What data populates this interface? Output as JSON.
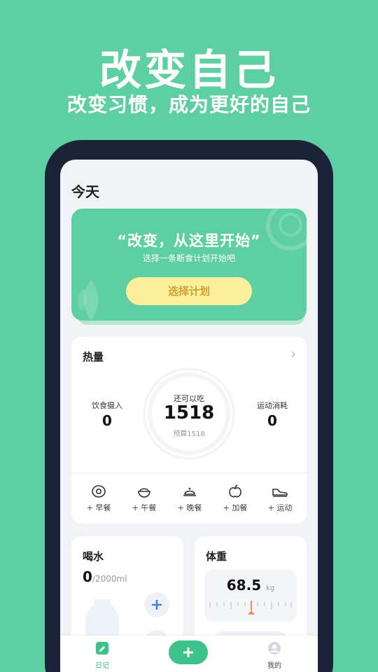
{
  "promo": {
    "title": "改变自己",
    "subtitle": "改变习惯，成为更好的自己"
  },
  "header": {
    "title": "今天"
  },
  "banner": {
    "quote": "“改变，从这里开始”",
    "desc": "选择一条断食计划开始吧",
    "button": "选择计划"
  },
  "calories": {
    "title": "热量",
    "intake_label": "饮食摄入",
    "intake_value": "0",
    "remaining_label": "还可以吃",
    "remaining_value": "1518",
    "budget": "预算1518",
    "burn_label": "运动消耗",
    "burn_value": "0",
    "meals": [
      {
        "label": "+ 早餐",
        "icon": "egg-icon"
      },
      {
        "label": "+ 午餐",
        "icon": "rice-bowl-icon"
      },
      {
        "label": "+ 晚餐",
        "icon": "cloche-icon"
      },
      {
        "label": "+ 加餐",
        "icon": "apple-icon"
      },
      {
        "label": "+ 运动",
        "icon": "sneaker-icon"
      }
    ]
  },
  "water": {
    "title": "喝水",
    "amount": "0",
    "goal": "/2000ml"
  },
  "weight": {
    "title": "体重",
    "value": "68.5",
    "unit": "kg"
  },
  "tabbar": {
    "diary_label": "日记",
    "mine_label": "我的"
  },
  "colors": {
    "brand": "#5ecfa2",
    "accent": "#3dc38a",
    "button_yellow": "#fbef9c",
    "button_text": "#d3a130",
    "frame": "#1b2338"
  }
}
